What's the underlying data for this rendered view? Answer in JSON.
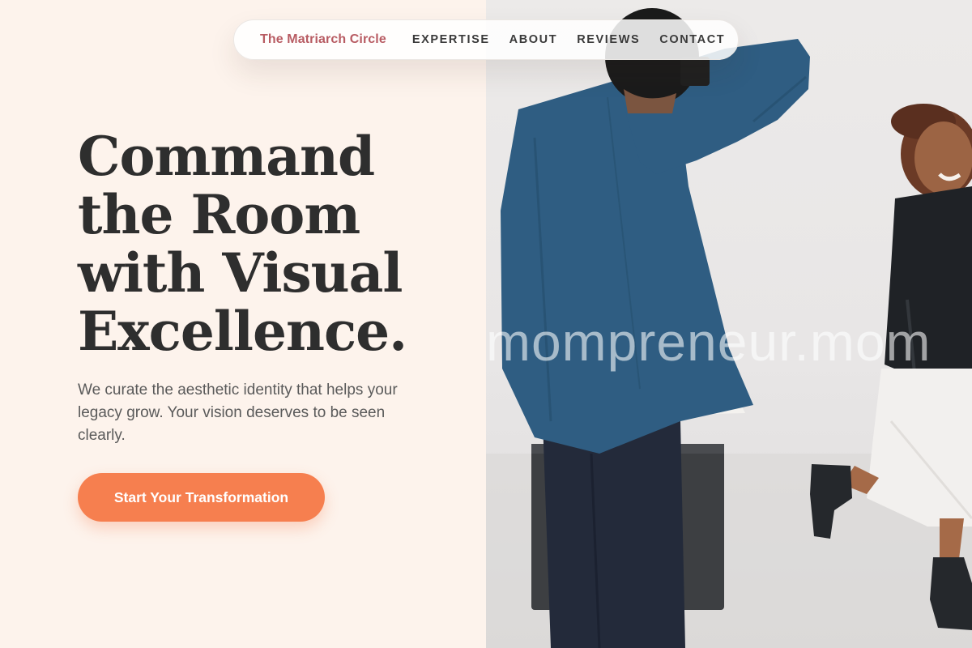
{
  "nav": {
    "brand": "The Matriarch Circle",
    "links": [
      "EXPERTISE",
      "ABOUT",
      "REVIEWS",
      "CONTACT"
    ]
  },
  "hero": {
    "headline_lines": [
      "Command",
      "the Room",
      "with Visual",
      "Excellence."
    ],
    "subtitle": "We curate the aesthetic identity that helps your legacy grow. Your vision deserves to be seen clearly.",
    "cta_label": "Start Your Transformation"
  },
  "image": {
    "watermark": "mompreneur.mom"
  },
  "colors": {
    "background": "#fdf3ec",
    "brand": "#b85c63",
    "accent": "#f67f4f",
    "heading": "#2e2e2e"
  }
}
